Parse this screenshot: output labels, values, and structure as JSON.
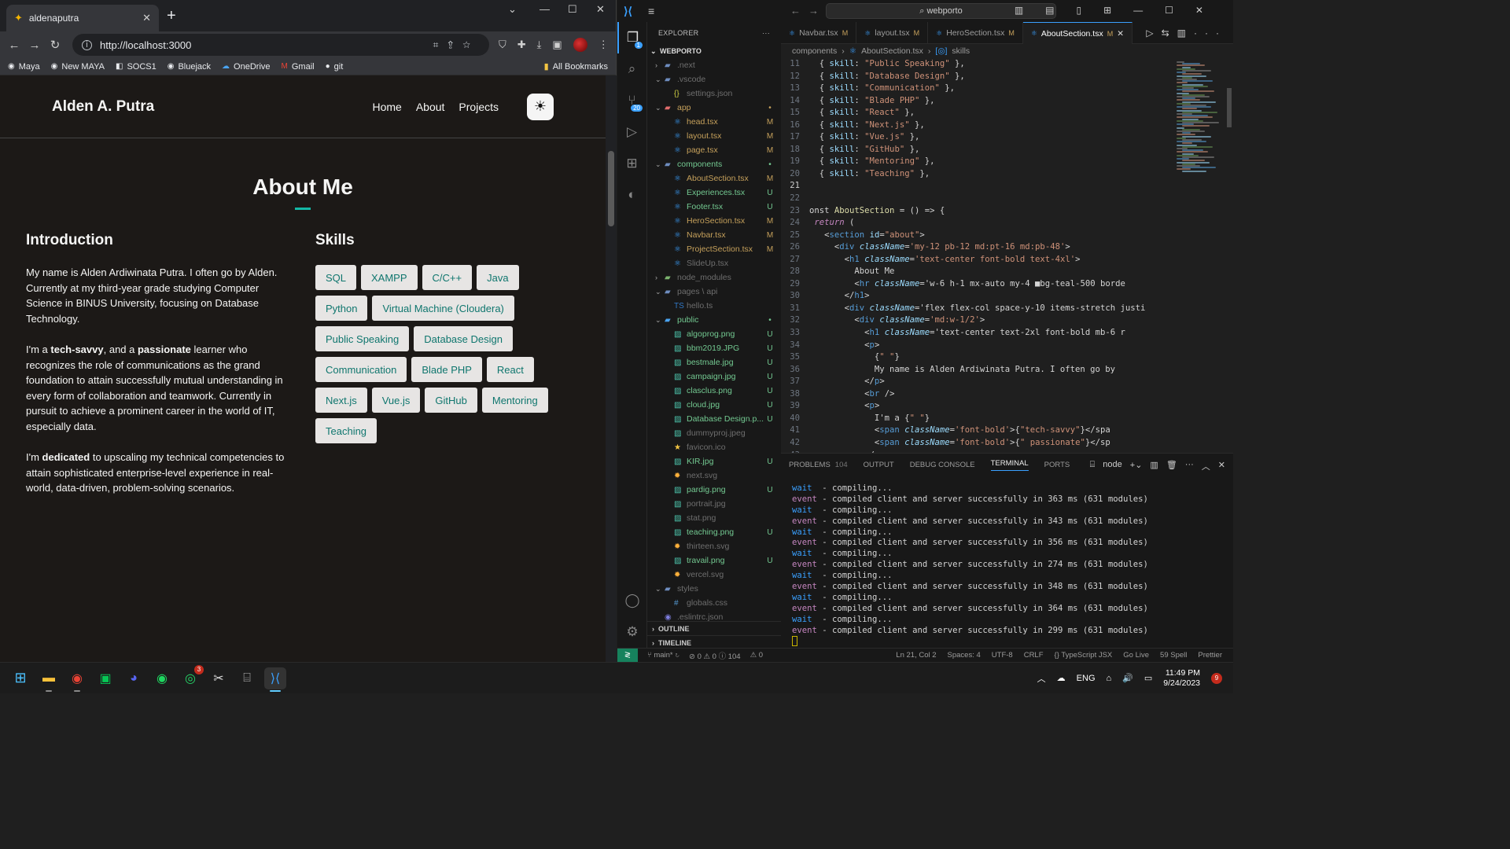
{
  "browser": {
    "tab_title": "aldenaputra",
    "url": "http://localhost:3000",
    "bookmarks": [
      "Maya",
      "New MAYA",
      "SOCS1",
      "Bluejack",
      "OneDrive",
      "Gmail",
      "git"
    ],
    "all_bookmarks": "All Bookmarks"
  },
  "site": {
    "brand": "Alden A. Putra",
    "nav": [
      "Home",
      "About",
      "Projects"
    ],
    "about_title": "About Me",
    "intro_heading": "Introduction",
    "skills_heading": "Skills",
    "para1": "My name is Alden Ardiwinata Putra. I often go by Alden. Currently at my third-year grade studying Computer Science in BINUS University, focusing on Database Technology.",
    "para2": {
      "a": "I'm a ",
      "b": "tech-savvy",
      "c": ", and a ",
      "d": "passionate",
      "e": " learner who recognizes the role of communications as the grand foundation to attain successfully mutual understanding in every form of collaboration and teamwork. Currently in pursuit to achieve a prominent career in the world of IT, especially data."
    },
    "para3": {
      "a": "I'm ",
      "b": "dedicated",
      "c": " to upscaling my technical competencies to attain sophisticated enterprise-level experience in real-world, data-driven, problem-solving scenarios."
    },
    "skills": [
      "SQL",
      "XAMPP",
      "C/C++",
      "Java",
      "Python",
      "Virtual Machine (Cloudera)",
      "Public Speaking",
      "Database Design",
      "Communication",
      "Blade PHP",
      "React",
      "Next.js",
      "Vue.js",
      "GitHub",
      "Mentoring",
      "Teaching"
    ]
  },
  "vscode": {
    "search": "webporto",
    "explorer_label": "EXPLORER",
    "project": "WEBPORTO",
    "tree": [
      {
        "name": ".next",
        "depth": 1,
        "type": "folder",
        "open": false,
        "color": "#6e6e6e",
        "status": ""
      },
      {
        "name": ".vscode",
        "depth": 1,
        "type": "folder",
        "open": true,
        "color": "#6e6e6e",
        "status": ""
      },
      {
        "name": "settings.json",
        "depth": 2,
        "type": "json",
        "color": "#6e6e6e",
        "status": ""
      },
      {
        "name": "app",
        "depth": 1,
        "type": "folder-red",
        "open": true,
        "color": "#c5a05b",
        "status": "•"
      },
      {
        "name": "head.tsx",
        "depth": 2,
        "type": "tsx",
        "color": "#c5a05b",
        "status": "M"
      },
      {
        "name": "layout.tsx",
        "depth": 2,
        "type": "tsx",
        "color": "#c5a05b",
        "status": "M"
      },
      {
        "name": "page.tsx",
        "depth": 2,
        "type": "tsx",
        "color": "#c5a05b",
        "status": "M"
      },
      {
        "name": "components",
        "depth": 1,
        "type": "folder",
        "open": true,
        "color": "#73c991",
        "status": "•"
      },
      {
        "name": "AboutSection.tsx",
        "depth": 2,
        "type": "tsx",
        "color": "#c5a05b",
        "status": "M"
      },
      {
        "name": "Experiences.tsx",
        "depth": 2,
        "type": "tsx",
        "color": "#73c991",
        "status": "U"
      },
      {
        "name": "Footer.tsx",
        "depth": 2,
        "type": "tsx",
        "color": "#73c991",
        "status": "U"
      },
      {
        "name": "HeroSection.tsx",
        "depth": 2,
        "type": "tsx",
        "color": "#c5a05b",
        "status": "M"
      },
      {
        "name": "Navbar.tsx",
        "depth": 2,
        "type": "tsx",
        "color": "#c5a05b",
        "status": "M"
      },
      {
        "name": "ProjectSection.tsx",
        "depth": 2,
        "type": "tsx",
        "color": "#c5a05b",
        "status": "M"
      },
      {
        "name": "SlideUp.tsx",
        "depth": 2,
        "type": "tsx",
        "color": "#6e6e6e",
        "status": ""
      },
      {
        "name": "node_modules",
        "depth": 1,
        "type": "folder-green",
        "open": false,
        "color": "#6e6e6e",
        "status": ""
      },
      {
        "name": "pages \\ api",
        "depth": 1,
        "type": "folder",
        "open": true,
        "color": "#6e6e6e",
        "status": ""
      },
      {
        "name": "hello.ts",
        "depth": 2,
        "type": "ts",
        "color": "#6e6e6e",
        "status": ""
      },
      {
        "name": "public",
        "depth": 1,
        "type": "folder-blue",
        "open": true,
        "color": "#73c991",
        "status": "•"
      },
      {
        "name": "algoprog.png",
        "depth": 2,
        "type": "img",
        "color": "#73c991",
        "status": "U"
      },
      {
        "name": "bbm2019.JPG",
        "depth": 2,
        "type": "img",
        "color": "#73c991",
        "status": "U"
      },
      {
        "name": "bestmale.jpg",
        "depth": 2,
        "type": "img",
        "color": "#73c991",
        "status": "U"
      },
      {
        "name": "campaign.jpg",
        "depth": 2,
        "type": "img",
        "color": "#73c991",
        "status": "U"
      },
      {
        "name": "clasclus.png",
        "depth": 2,
        "type": "img",
        "color": "#73c991",
        "status": "U"
      },
      {
        "name": "cloud.jpg",
        "depth": 2,
        "type": "img",
        "color": "#73c991",
        "status": "U"
      },
      {
        "name": "Database Design.p...",
        "depth": 2,
        "type": "img",
        "color": "#73c991",
        "status": "U"
      },
      {
        "name": "dummyproj.jpeg",
        "depth": 2,
        "type": "img",
        "color": "#6e6e6e",
        "status": ""
      },
      {
        "name": "favicon.ico",
        "depth": 2,
        "type": "star",
        "color": "#6e6e6e",
        "status": ""
      },
      {
        "name": "KIR.jpg",
        "depth": 2,
        "type": "img",
        "color": "#73c991",
        "status": "U"
      },
      {
        "name": "next.svg",
        "depth": 2,
        "type": "svg",
        "color": "#6e6e6e",
        "status": ""
      },
      {
        "name": "pardig.png",
        "depth": 2,
        "type": "img",
        "color": "#73c991",
        "status": "U"
      },
      {
        "name": "portrait.jpg",
        "depth": 2,
        "type": "img",
        "color": "#6e6e6e",
        "status": ""
      },
      {
        "name": "stat.png",
        "depth": 2,
        "type": "img",
        "color": "#6e6e6e",
        "status": ""
      },
      {
        "name": "teaching.png",
        "depth": 2,
        "type": "img",
        "color": "#73c991",
        "status": "U"
      },
      {
        "name": "thirteen.svg",
        "depth": 2,
        "type": "svg",
        "color": "#6e6e6e",
        "status": ""
      },
      {
        "name": "travail.png",
        "depth": 2,
        "type": "img",
        "color": "#73c991",
        "status": "U"
      },
      {
        "name": "vercel.svg",
        "depth": 2,
        "type": "svg",
        "color": "#6e6e6e",
        "status": ""
      },
      {
        "name": "styles",
        "depth": 1,
        "type": "folder",
        "open": true,
        "color": "#6e6e6e",
        "status": ""
      },
      {
        "name": "globals.css",
        "depth": 2,
        "type": "css",
        "color": "#6e6e6e",
        "status": ""
      },
      {
        "name": ".eslintrc.json",
        "depth": 1,
        "type": "eslint",
        "color": "#6e6e6e",
        "status": ""
      }
    ],
    "outline": "OUTLINE",
    "timeline": "TIMELINE",
    "tabs": [
      {
        "name": "Navbar.tsx",
        "mod": "M"
      },
      {
        "name": "layout.tsx",
        "mod": "M"
      },
      {
        "name": "HeroSection.tsx",
        "mod": "M"
      },
      {
        "name": "AboutSection.tsx",
        "mod": "M",
        "active": true
      }
    ],
    "breadcrumb": [
      "components",
      "AboutSection.tsx",
      "skills"
    ],
    "code_start_line": 11,
    "current_line": 21,
    "code": [
      "  { skill: \"Public Speaking\" },",
      "  { skill: \"Database Design\" },",
      "  { skill: \"Communication\" },",
      "  { skill: \"Blade PHP\" },",
      "  { skill: \"React\" },",
      "  { skill: \"Next.js\" },",
      "  { skill: \"Vue.js\" },",
      "  { skill: \"GitHub\" },",
      "  { skill: \"Mentoring\" },",
      "  { skill: \"Teaching\" },",
      "",
      "",
      "onst AboutSection = () => {",
      " return (",
      "   <section id=\"about\">",
      "     <div className='my-12 pb-12 md:pt-16 md:pb-48'>",
      "       <h1 className='text-center font-bold text-4xl'>",
      "         About Me",
      "         <hr className='w-6 h-1 mx-auto my-4 ■bg-teal-500 borde",
      "       </h1>",
      "       <div className='flex flex-col space-y-10 items-stretch justi",
      "         <div className='md:w-1/2'>",
      "           <h1 className='text-center text-2xl font-bold mb-6 r",
      "           <p>",
      "             {\" \"}",
      "             My name is Alden Ardiwinata Putra. I often go by",
      "           </p>",
      "           <br />",
      "           <p>",
      "             I'm a {\" \"}",
      "             <span className='font-bold'>{\"tech-savvy\"}</spa",
      "             <span className='font-bold'>{\" passionate\"}</sp",
      "           </p>"
    ],
    "panel_tabs": [
      "PROBLEMS",
      "OUTPUT",
      "DEBUG CONSOLE",
      "TERMINAL",
      "PORTS"
    ],
    "problems_count": "104",
    "terminal_shell": "node",
    "terminal": [
      {
        "k": "wait",
        "t": "  - compiling..."
      },
      {
        "k": "event",
        "t": " - compiled client and server successfully in 363 ms (631 modules)"
      },
      {
        "k": "wait",
        "t": "  - compiling..."
      },
      {
        "k": "event",
        "t": " - compiled client and server successfully in 343 ms (631 modules)"
      },
      {
        "k": "wait",
        "t": "  - compiling..."
      },
      {
        "k": "event",
        "t": " - compiled client and server successfully in 356 ms (631 modules)"
      },
      {
        "k": "wait",
        "t": "  - compiling..."
      },
      {
        "k": "event",
        "t": " - compiled client and server successfully in 274 ms (631 modules)"
      },
      {
        "k": "wait",
        "t": "  - compiling..."
      },
      {
        "k": "event",
        "t": " - compiled client and server successfully in 348 ms (631 modules)"
      },
      {
        "k": "wait",
        "t": "  - compiling..."
      },
      {
        "k": "event",
        "t": " - compiled client and server successfully in 364 ms (631 modules)"
      },
      {
        "k": "wait",
        "t": "  - compiling..."
      },
      {
        "k": "event",
        "t": " - compiled client and server successfully in 299 ms (631 modules)"
      }
    ],
    "status_left": [
      "main*",
      "⊘ 0 ⚠ 0 ⓘ 104",
      "⚠ 0"
    ],
    "status_right": [
      "Ln 21, Col 2",
      "Spaces: 4",
      "UTF-8",
      "CRLF",
      "{} TypeScript JSX",
      "Go Live",
      "59 Spell",
      "Prettier"
    ]
  },
  "taskbar": {
    "lang": "ENG",
    "time": "11:49 PM",
    "date": "9/24/2023",
    "notifications": "9",
    "whatsapp_badge": "3"
  }
}
